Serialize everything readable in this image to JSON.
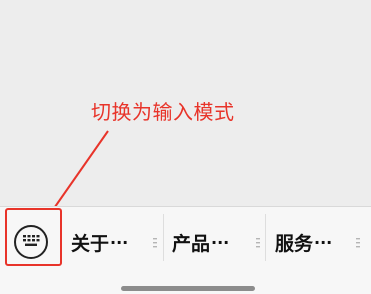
{
  "annotation": {
    "text": "切换为输入模式",
    "color": "#e8342a"
  },
  "menu": {
    "toggle_icon": "keyboard-icon",
    "items": [
      {
        "label": "关于",
        "ellipsis": "···"
      },
      {
        "label": "产品",
        "ellipsis": "···"
      },
      {
        "label": "服务",
        "ellipsis": "···"
      }
    ]
  }
}
